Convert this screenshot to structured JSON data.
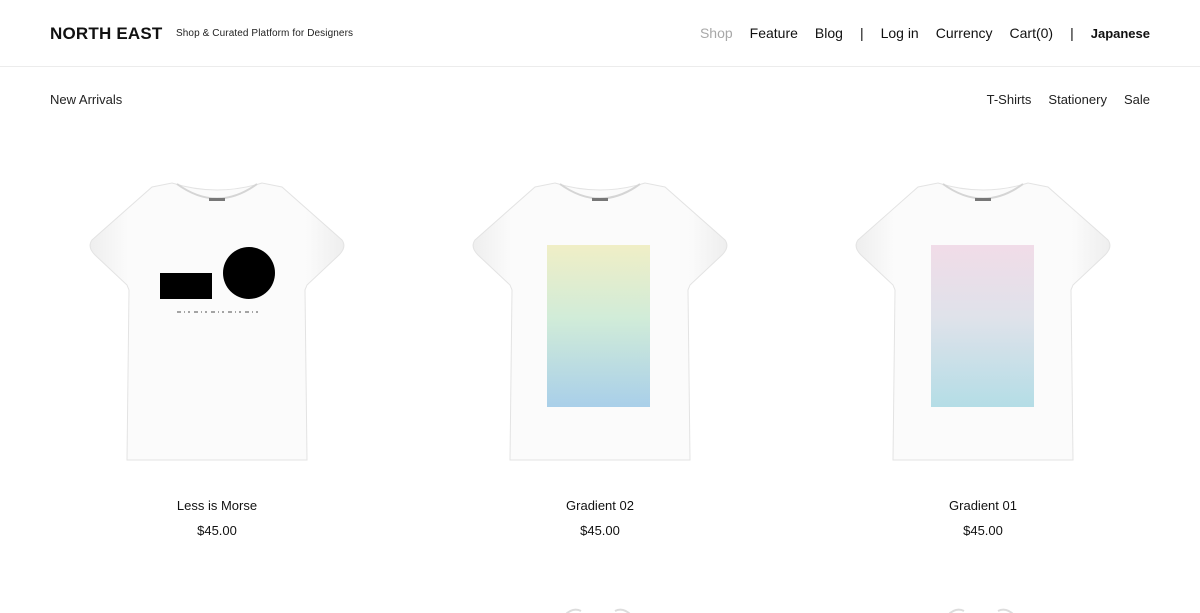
{
  "header": {
    "brand": "NORTH EAST",
    "tagline": "Shop & Curated Platform for Designers",
    "nav": {
      "shop": "Shop",
      "feature": "Feature",
      "blog": "Blog",
      "separator": "|",
      "login": "Log in",
      "currency": "Currency",
      "cart": "Cart(0)",
      "language": "Japanese"
    }
  },
  "subheader": {
    "title": "New Arrivals",
    "categories": [
      "T-Shirts",
      "Stationery",
      "Sale"
    ]
  },
  "products": [
    {
      "name": "Less is Morse",
      "price": "$45.00",
      "print": "morse shapes"
    },
    {
      "name": "Gradient 02",
      "price": "$45.00",
      "print": "yellow-to-blue gradient"
    },
    {
      "name": "Gradient 01",
      "price": "$45.00",
      "print": "pink-to-cyan gradient"
    }
  ],
  "colors": {
    "muted_nav": "#a8a8a8",
    "text": "#111111",
    "divider": "#ececec"
  }
}
